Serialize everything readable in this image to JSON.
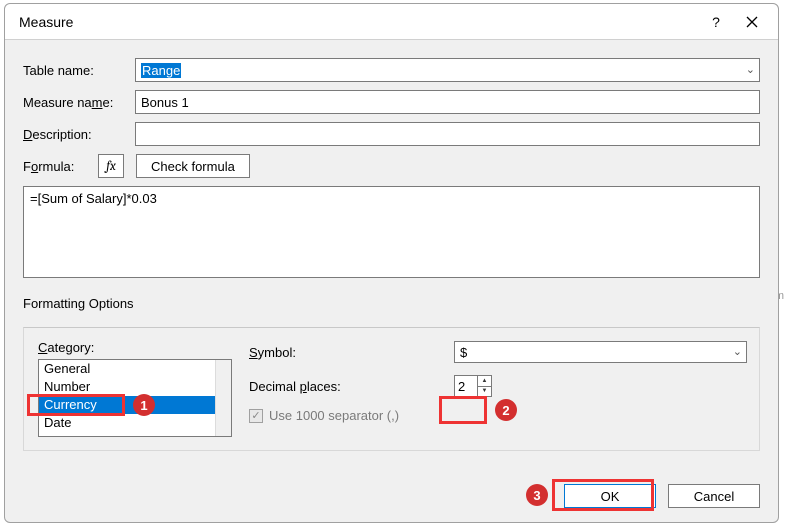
{
  "dialog": {
    "title": "Measure",
    "help_label": "?",
    "close_label": "×"
  },
  "fields": {
    "table_name_label": "Table name:",
    "table_name_value": "Range",
    "measure_name_label": "Measure name:",
    "measure_name_value": "Bonus 1",
    "description_label": "Description:",
    "description_value": "",
    "formula_label": "Formula:",
    "fx_label": "fx",
    "check_formula_label": "Check formula",
    "formula_value": "=[Sum of Salary]*0.03"
  },
  "formatting": {
    "section_label": "Formatting Options",
    "category_label": "Category:",
    "categories": [
      "General",
      "Number",
      "Currency",
      "Date"
    ],
    "selected_index": 2,
    "symbol_label": "Symbol:",
    "symbol_value": "$",
    "decimal_label": "Decimal places:",
    "decimal_value": "2",
    "separator_label": "Use 1000 separator (,)",
    "separator_checked": true
  },
  "buttons": {
    "ok": "OK",
    "cancel": "Cancel"
  },
  "callouts": {
    "c1": "1",
    "c2": "2",
    "c3": "3"
  },
  "watermark": "wsxdn.com"
}
